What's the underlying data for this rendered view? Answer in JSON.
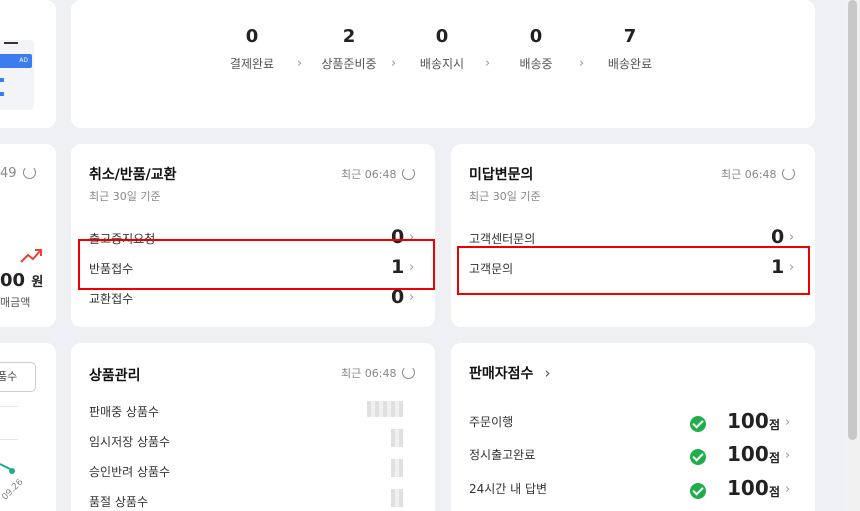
{
  "order_status": {
    "items": [
      {
        "count": "0",
        "label": "결제완료"
      },
      {
        "count": "2",
        "label": "상품준비중"
      },
      {
        "count": "0",
        "label": "배송지시"
      },
      {
        "count": "0",
        "label": "배송중"
      },
      {
        "count": "7",
        "label": "배송완료"
      }
    ],
    "arrow": "›"
  },
  "left_partial": {
    "time_fragment": "49",
    "amount_fragment": "00",
    "unit": "원",
    "caption_fragment": "매금액",
    "button_fragment": "품수",
    "date_fragment": "09.26"
  },
  "claims": {
    "title": "취소/반품/교환",
    "subtitle": "최근 30일 기준",
    "updated": "최근 06:48",
    "rows": [
      {
        "label": "출고중지요청",
        "value": "0"
      },
      {
        "label": "반품접수",
        "value": "1"
      },
      {
        "label": "교환접수",
        "value": "0"
      }
    ]
  },
  "inquiries": {
    "title": "미답변문의",
    "subtitle": "최근 30일 기준",
    "updated": "최근 06:48",
    "rows": [
      {
        "label": "고객센터문의",
        "value": "0"
      },
      {
        "label": "고객문의",
        "value": "1"
      }
    ]
  },
  "products": {
    "title": "상품관리",
    "updated": "최근 06:48",
    "rows": [
      {
        "label": "판매중 상품수"
      },
      {
        "label": "임시저장 상품수"
      },
      {
        "label": "승인반려 상품수"
      },
      {
        "label": "품절 상품수"
      }
    ]
  },
  "seller_score": {
    "title": "판매자점수",
    "title_arrow": "›",
    "rows": [
      {
        "label": "주문이행",
        "score": "100",
        "unit": "점"
      },
      {
        "label": "정시출고완료",
        "score": "100",
        "unit": "점"
      },
      {
        "label": "24시간 내 답변",
        "score": "100",
        "unit": "점"
      }
    ]
  },
  "colors": {
    "highlight": "#e00000",
    "check": "#1fae4b",
    "trend": "#e8442e",
    "chart_line": "#1fae8a"
  }
}
